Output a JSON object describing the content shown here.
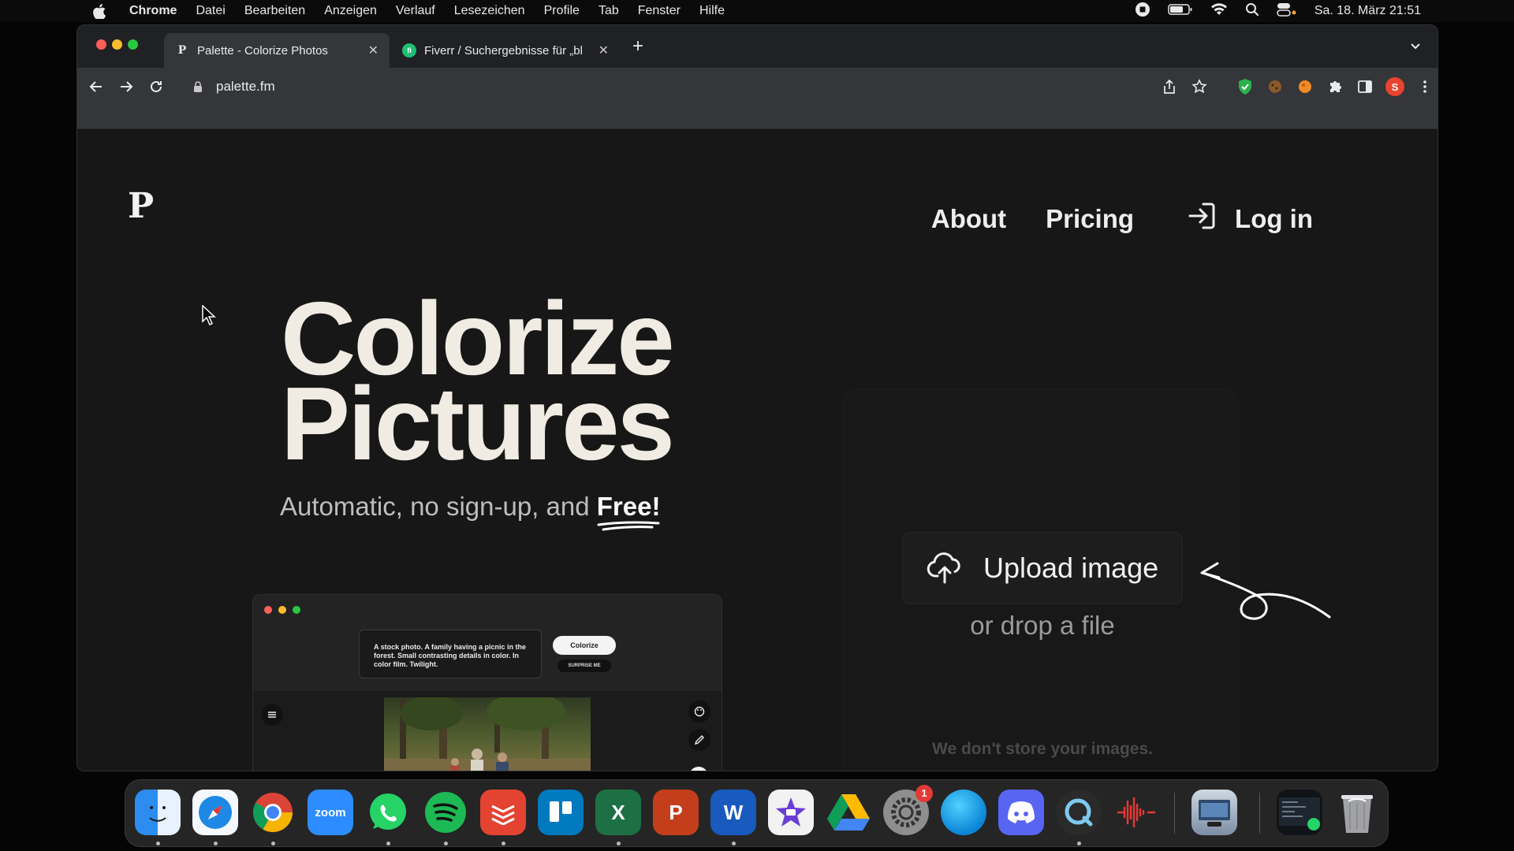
{
  "menubar": {
    "app_name": "Chrome",
    "items": [
      "Datei",
      "Bearbeiten",
      "Anzeigen",
      "Verlauf",
      "Lesezeichen",
      "Profile",
      "Tab",
      "Fenster",
      "Hilfe"
    ],
    "clock": "Sa. 18. März  21:51"
  },
  "browser": {
    "tabs": [
      {
        "favicon": "P",
        "title": "Palette - Colorize Photos"
      },
      {
        "favicon": "fi",
        "title": "Fiverr / Suchergebnisse für „bl"
      }
    ],
    "new_tab": "+",
    "url": "palette.fm",
    "profile_initial": "S"
  },
  "page": {
    "logo": "P",
    "nav": {
      "about": "About",
      "pricing": "Pricing",
      "login": "Log in"
    },
    "hero": {
      "line1": "Colorize",
      "line2": "Pictures",
      "subtitle_prefix": "Automatic, no sign-up, and ",
      "subtitle_emphasis": "Free!"
    },
    "preview": {
      "prompt": "A stock photo. A family having a picnic in the forest. Small contrasting details in color. In color film. Twilight.",
      "colorize_label": "Colorize",
      "surprise_label": "SURPRISE ME"
    },
    "upload": {
      "button_label": "Upload image",
      "drop_text": "or drop a file",
      "privacy_note": "We don't store your images."
    }
  },
  "dock": {
    "zoom_label": "zoom",
    "excel_label": "X",
    "powerpoint_label": "P",
    "word_label": "W",
    "settings_badge": "1"
  },
  "colors": {
    "page_bg": "#171717",
    "hero_text": "#f0ece4",
    "tab_active": "#35363a",
    "tab_bar": "#202124"
  }
}
